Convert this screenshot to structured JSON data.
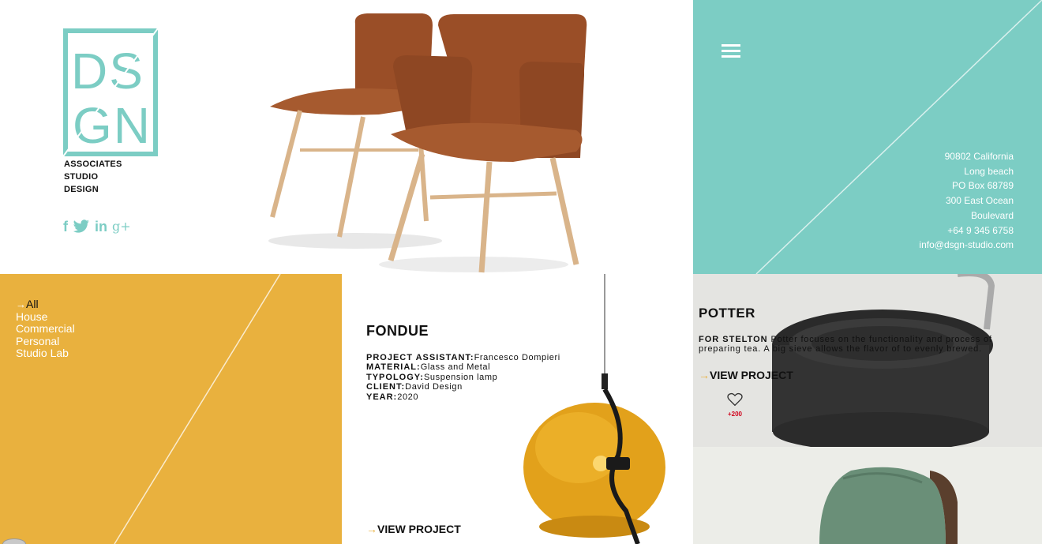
{
  "brand": {
    "logo_letters_top": "DS",
    "logo_letters_bottom": "GN",
    "tagline_lines": [
      "ASSOCIATES",
      "STUDIO",
      "DESIGN"
    ],
    "accent_color": "#7ccdc4",
    "yellow_color": "#e9b13e"
  },
  "social": [
    {
      "name": "facebook-icon",
      "glyph": "f"
    },
    {
      "name": "twitter-icon",
      "glyph": "🐦"
    },
    {
      "name": "linkedin-icon",
      "glyph": "in"
    },
    {
      "name": "googleplus-icon",
      "glyph": "g+"
    }
  ],
  "contact": {
    "line1": "90802 California",
    "line2": "Long beach",
    "line3": "PO Box 68789",
    "line4": "300 East Ocean",
    "line5": "Boulevard",
    "phone": "+64 9 345 6758",
    "email": "info@dsgn-studio.com"
  },
  "filters": [
    {
      "label": "All",
      "active": true
    },
    {
      "label": "House",
      "active": false
    },
    {
      "label": "Commercial",
      "active": false
    },
    {
      "label": "Personal",
      "active": false
    },
    {
      "label": "Studio Lab",
      "active": false
    }
  ],
  "fondue": {
    "title": "FONDUE",
    "assistant_key": "PROJECT ASSISTANT:",
    "assistant_val": "Francesco Dompieri",
    "material_key": "MATERIAL:",
    "material_val": "Glass and Metal",
    "typology_key": "TYPOLOGY:",
    "typology_val": "Suspension lamp",
    "client_key": "CLIENT:",
    "client_val": "David Design",
    "year_key": "YEAR:",
    "year_val": "2020",
    "view_label": "VIEW PROJECT"
  },
  "potter": {
    "title": "POTTER",
    "desc_key": "FOR STELTON",
    "desc_val": " Potter focuses on the functionality and process of preparing tea. A big sieve allows the flavor of to evenly brewed.",
    "view_label": "VIEW PROJECT",
    "like_count": "+200"
  },
  "arrow_glyph": "→"
}
